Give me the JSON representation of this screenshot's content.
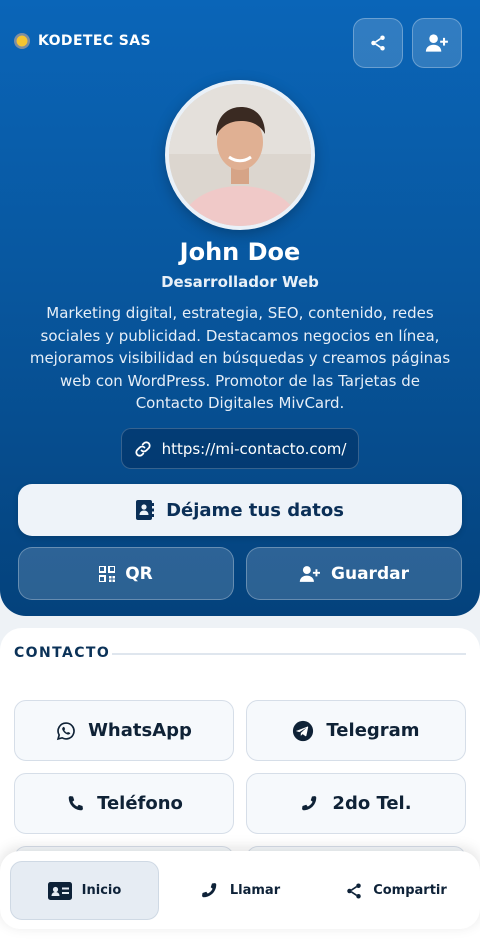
{
  "brand": {
    "name": "KODETEC SAS"
  },
  "profile": {
    "name": "John Doe",
    "role": "Desarrollador Web",
    "bio": "Marketing digital, estrategia, SEO, contenido, redes sociales y publicidad. Destacamos negocios en línea, mejoramos visibilidad en búsquedas y creamos páginas web con WordPress. Promotor de las Tarjetas de Contacto Digitales MivCard.",
    "website": "https://mi-contacto.com/"
  },
  "actions": {
    "cta": "Déjame tus datos",
    "qr": "QR",
    "save": "Guardar"
  },
  "contact": {
    "title": "CONTACTO",
    "buttons": [
      {
        "label": "WhatsApp",
        "icon": "whatsapp-icon"
      },
      {
        "label": "Telegram",
        "icon": "telegram-icon"
      },
      {
        "label": "Teléfono",
        "icon": "phone-icon"
      },
      {
        "label": "2do Tel.",
        "icon": "phone-alt-icon"
      }
    ]
  },
  "nav": {
    "items": [
      {
        "label": "Inicio",
        "icon": "id-card-icon",
        "active": true
      },
      {
        "label": "Llamar",
        "icon": "phone-icon",
        "active": false
      },
      {
        "label": "Compartir",
        "icon": "share-icon",
        "active": false
      }
    ]
  },
  "colors": {
    "hero_top": "#0a65b8",
    "hero_bottom": "#04427c",
    "accent_dark": "#0b2f57"
  }
}
